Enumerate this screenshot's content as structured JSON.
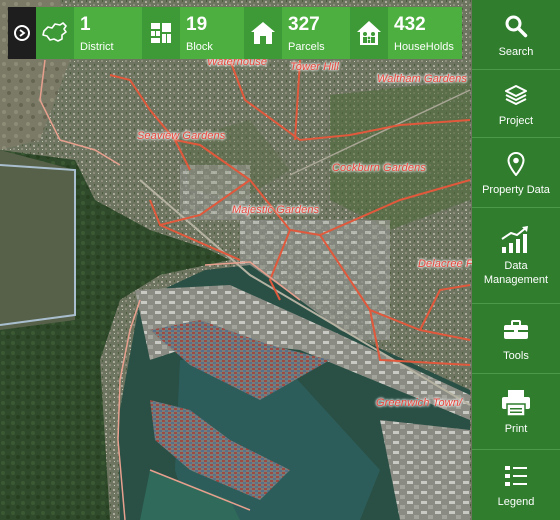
{
  "stats": [
    {
      "icon": "china-map-icon",
      "value": "1",
      "label": "District"
    },
    {
      "icon": "block-grid-icon",
      "value": "19",
      "label": "Block"
    },
    {
      "icon": "house-icon",
      "value": "327",
      "label": "Parcels"
    },
    {
      "icon": "family-house-icon",
      "value": "432",
      "label": "HouseHolds"
    }
  ],
  "menu": [
    {
      "icon": "search-icon",
      "label": "Search"
    },
    {
      "icon": "layers-icon",
      "label": "Project"
    },
    {
      "icon": "map-pin-icon",
      "label": "Property Data"
    },
    {
      "icon": "bar-chart-icon",
      "label": "Data Management"
    },
    {
      "icon": "toolbox-icon",
      "label": "Tools"
    },
    {
      "icon": "printer-icon",
      "label": "Print"
    },
    {
      "icon": "legend-list-icon",
      "label": "Legend"
    }
  ],
  "map_labels": [
    "Waterhouse",
    "Tower Hill",
    "Waltham Gardens",
    "Seaview Gardens",
    "Cockburn Gardens",
    "Majestic Gardens",
    "Delacree Pen",
    "Greenwich Town/"
  ],
  "colors": {
    "menu_bg": "#2f7d2d",
    "stat_value_bg": "#4caf3f",
    "stat_icon_bg": "#3d9a36",
    "boundary": "#e0593c",
    "label": "#e8463c"
  }
}
